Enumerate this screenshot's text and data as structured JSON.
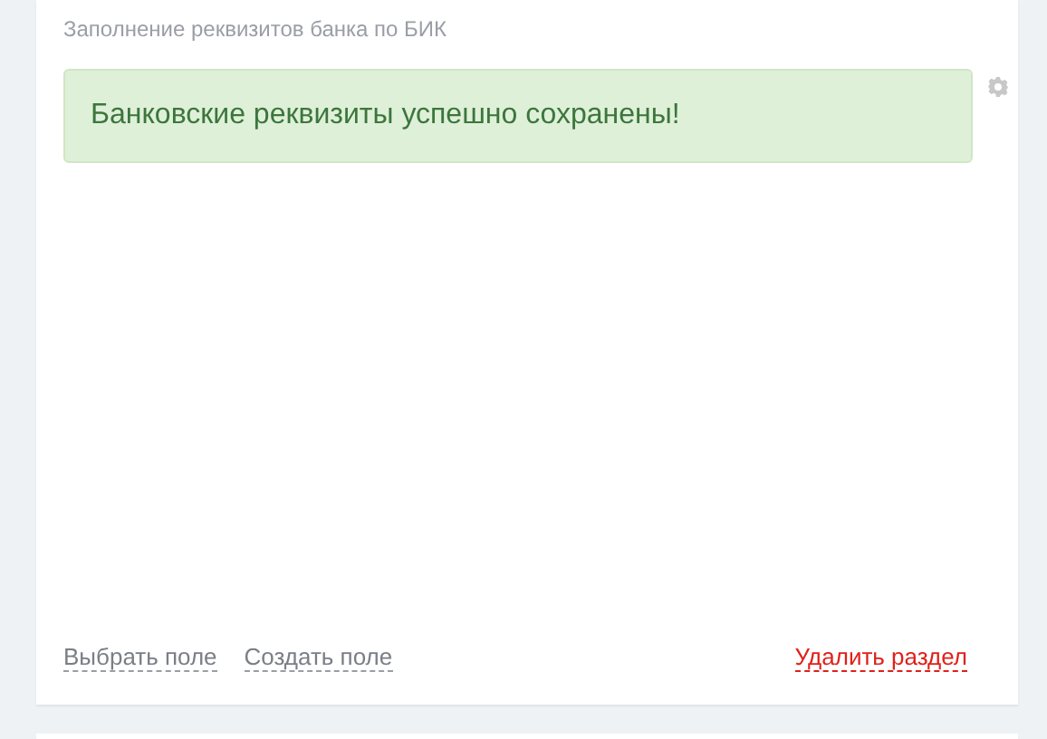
{
  "section": {
    "title": "Заполнение реквизитов банка по БИК",
    "alert": {
      "kind": "success",
      "text": "Банковские реквизиты успешно сохранены!"
    },
    "actions": [
      {
        "kind": "neutral",
        "label": "Выбрать поле"
      },
      {
        "kind": "neutral",
        "label": "Создать поле"
      },
      {
        "kind": "danger",
        "label": "Удалить раздел"
      }
    ]
  }
}
